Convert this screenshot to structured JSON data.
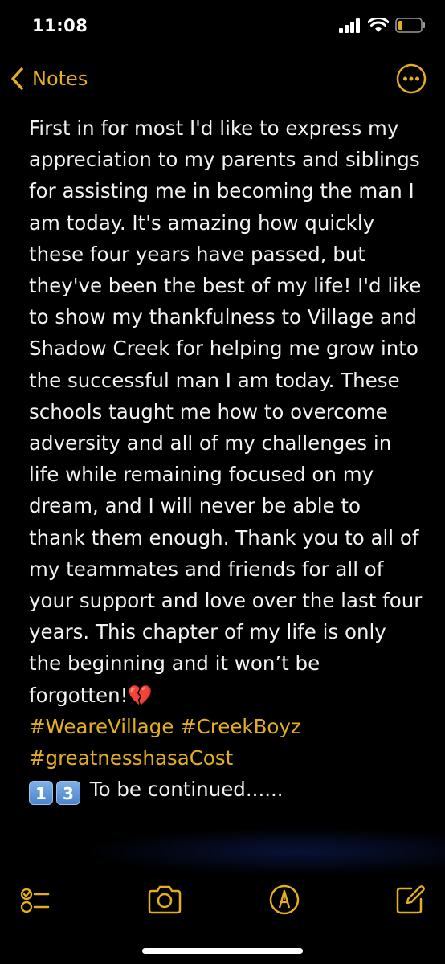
{
  "status_bar": {
    "time": "11:08"
  },
  "nav": {
    "back_label": "Notes"
  },
  "note": {
    "body_text": "First in for most I'd like to express my appreciation to my parents and siblings for assisting me in becoming the man I am today. It's amazing how quickly these four years have passed, but they've been the best of my life! I'd like to show my thankfulness to Village and Shadow Creek for helping me grow into the successful man I am today. These schools taught me how to overcome adversity and all of my challenges in life while remaining focused on my dream, and I will never be able to thank them enough. Thank you to all of my teammates and friends for all of your support and love over the last four years. This chapter of my life is only the beginning and it won’t be forgotten!💔",
    "hashtag_line_1": "#WeareVillage #CreekBoyz",
    "hashtag_line_2": "#greatnesshasaCost",
    "keycap_1": "1",
    "keycap_2": "3",
    "continued_text": " To be continued......"
  },
  "colors": {
    "accent": "#e4ae1f",
    "background": "#000000",
    "text": "#f2f2f2"
  },
  "icons": {
    "back": "chevron-left-icon",
    "more": "ellipsis-circle-icon",
    "checklist": "checklist-icon",
    "camera": "camera-icon",
    "markup": "markup-pen-icon",
    "compose": "compose-icon",
    "signal": "cellular-signal-icon",
    "wifi": "wifi-icon",
    "battery": "battery-icon"
  }
}
